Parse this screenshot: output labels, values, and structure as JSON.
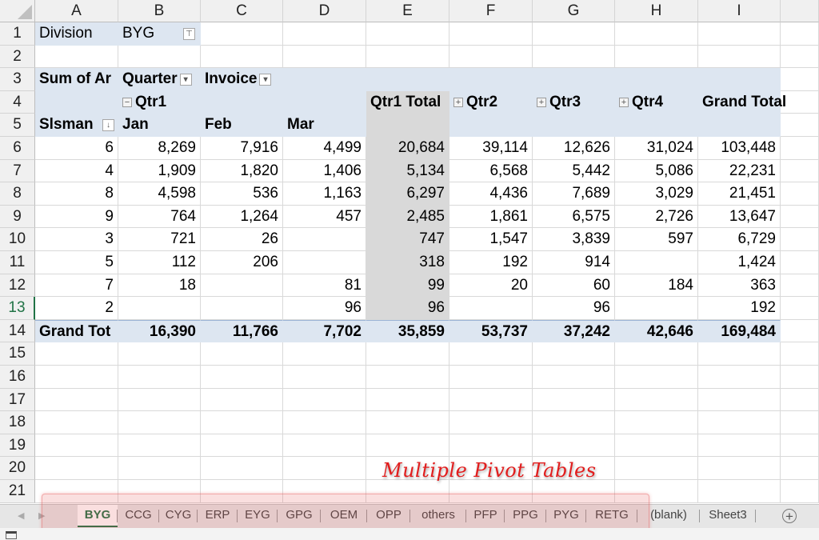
{
  "columns": [
    "A",
    "B",
    "C",
    "D",
    "E",
    "F",
    "G",
    "H",
    "I"
  ],
  "rows": [
    "1",
    "2",
    "3",
    "4",
    "5",
    "6",
    "7",
    "8",
    "9",
    "10",
    "11",
    "12",
    "13",
    "14",
    "15",
    "16",
    "17",
    "18",
    "19",
    "20",
    "21"
  ],
  "selected_row": "13",
  "filter": {
    "label": "Division",
    "value": "BYG"
  },
  "pivot": {
    "data_field": "Sum of Ar",
    "col_field_1": "Quarter",
    "col_field_2": "Invoice",
    "row_field": "Slsman",
    "qtr1": "Qtr1",
    "qtr1_total": "Qtr1 Total",
    "qtr2": "Qtr2",
    "qtr3": "Qtr3",
    "qtr4": "Qtr4",
    "grand_total_header": "Grand Total",
    "months": [
      "Jan",
      "Feb",
      "Mar"
    ],
    "body": [
      [
        "6",
        "8,269",
        "7,916",
        "4,499",
        "20,684",
        "39,114",
        "12,626",
        "31,024",
        "103,448"
      ],
      [
        "4",
        "1,909",
        "1,820",
        "1,406",
        "5,134",
        "6,568",
        "5,442",
        "5,086",
        "22,231"
      ],
      [
        "8",
        "4,598",
        "536",
        "1,163",
        "6,297",
        "4,436",
        "7,689",
        "3,029",
        "21,451"
      ],
      [
        "9",
        "764",
        "1,264",
        "457",
        "2,485",
        "1,861",
        "6,575",
        "2,726",
        "13,647"
      ],
      [
        "3",
        "721",
        "26",
        "",
        "747",
        "1,547",
        "3,839",
        "597",
        "6,729"
      ],
      [
        "5",
        "112",
        "206",
        "",
        "318",
        "192",
        "914",
        "",
        "1,424"
      ],
      [
        "7",
        "18",
        "",
        "81",
        "99",
        "20",
        "60",
        "184",
        "363"
      ],
      [
        "2",
        "",
        "",
        "96",
        "96",
        "",
        "96",
        "",
        "192"
      ]
    ],
    "grand_total_row": [
      "Grand Tot",
      "16,390",
      "11,766",
      "7,702",
      "35,859",
      "53,737",
      "37,242",
      "42,646",
      "169,484"
    ]
  },
  "annotation": "Multiple Pivot Tables",
  "sheet_tabs": [
    "BYG",
    "CCG",
    "CYG",
    "ERP",
    "EYG",
    "GPG",
    "OEM",
    "OPP",
    "others",
    "PFP",
    "PPG",
    "PYG",
    "RETG",
    "(blank)",
    "Sheet3"
  ],
  "active_tab": "BYG",
  "icons": {
    "add_sheet": "⊕",
    "filter": "filter-icon",
    "expand": "+",
    "collapse": "−"
  }
}
